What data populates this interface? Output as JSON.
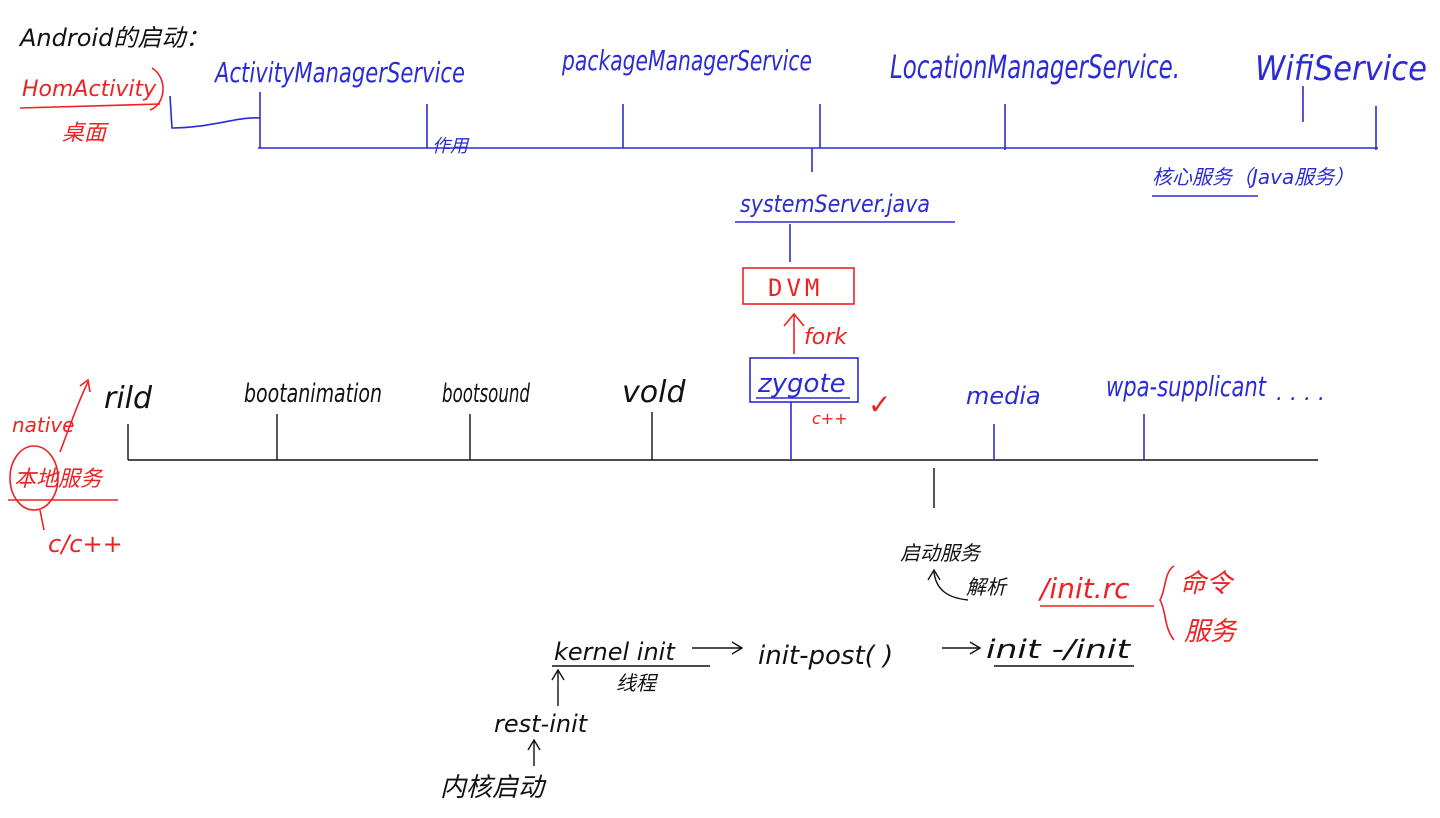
{
  "title": "Android的启动：",
  "side_notes": {
    "home_activity": "HomActivity",
    "desktop": "桌面",
    "native": "native",
    "local_service": "本地服务",
    "c_cpp": "c/c++",
    "cpp_mark": "c++",
    "check": "✓",
    "upper_lang_note": "作用",
    "core_services": "核心服务（Java服务）"
  },
  "java_services": [
    "ActivityManagerService",
    "packageManagerService",
    "LocationManagerService.",
    "WifiService"
  ],
  "system_server": "systemServer.java",
  "dvm": "DVM",
  "fork": "fork",
  "zygote": "zygote",
  "native_services": [
    "rild",
    "bootanimation",
    "bootsound",
    "vold",
    "media",
    "wpa-supplicant"
  ],
  "ellipsis": ". . . .",
  "boot_chain": {
    "kernel_start": "内核启动",
    "rest_init": "rest-init",
    "kernel_init": "kernel init",
    "kernel_init_note": "线程",
    "init_post": "init-post( )",
    "init": "init -/init",
    "parse": "解析",
    "start_service": "启动服务",
    "init_rc": "/init.rc",
    "command_service": [
      "命令",
      "服务"
    ]
  },
  "colors": {
    "blue": "#2b2bd6",
    "red": "#ee2222",
    "black": "#111111"
  }
}
